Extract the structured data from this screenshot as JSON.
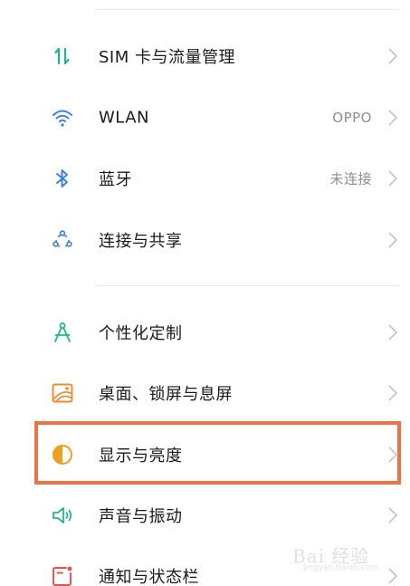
{
  "settings": {
    "items": [
      {
        "label": "SIM 卡与流量管理",
        "value": "",
        "icon": "sim-data-icon",
        "color": "#21b68a"
      },
      {
        "label": "WLAN",
        "value": "OPPO",
        "icon": "wifi-icon",
        "color": "#3d7ee0"
      },
      {
        "label": "蓝牙",
        "value": "未连接",
        "icon": "bluetooth-icon",
        "color": "#3d7ee0"
      },
      {
        "label": "连接与共享",
        "value": "",
        "icon": "share-connection-icon",
        "color": "#3d7ee0"
      },
      {
        "label": "个性化定制",
        "value": "",
        "icon": "compass-customize-icon",
        "color": "#21b68a"
      },
      {
        "label": "桌面、锁屏与息屏",
        "value": "",
        "icon": "wallpaper-icon",
        "color": "#ef8a2e"
      },
      {
        "label": "显示与亮度",
        "value": "",
        "icon": "brightness-icon",
        "color": "#f0a020"
      },
      {
        "label": "声音与振动",
        "value": "",
        "icon": "speaker-icon",
        "color": "#21b68a"
      },
      {
        "label": "通知与状态栏",
        "value": "",
        "icon": "notification-icon",
        "color": "#e8504a"
      }
    ]
  },
  "highlight": {
    "color": "#ef7145",
    "target": "显示与亮度"
  },
  "watermark": {
    "main": "Bai 经验",
    "sub": "jingyan.baidu.com"
  }
}
